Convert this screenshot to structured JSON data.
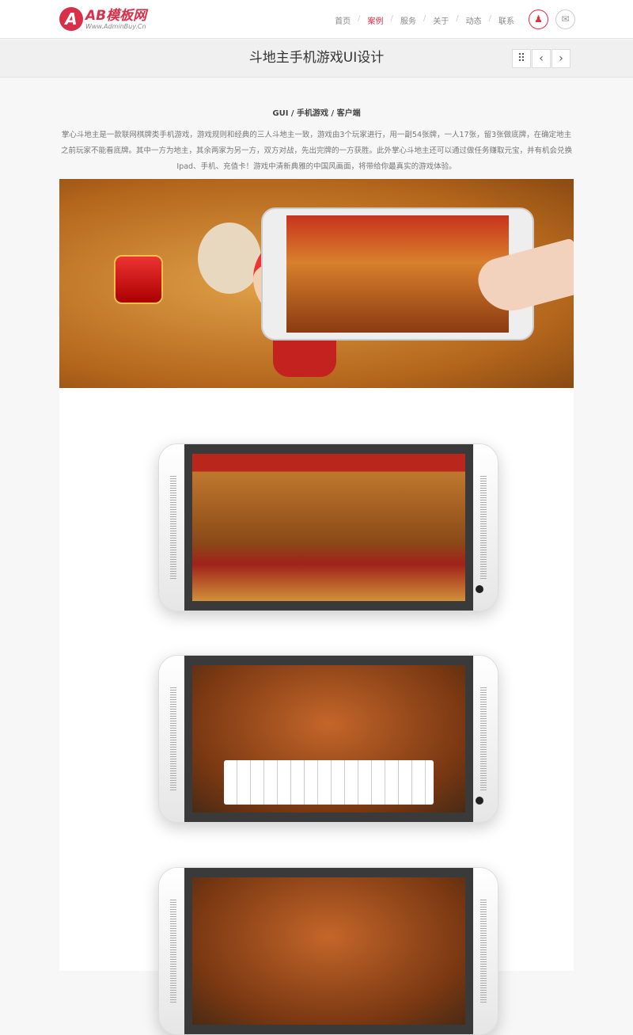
{
  "logo": {
    "name": "AB模板网",
    "url": "Www.AdminBuy.Cn",
    "mark": "A"
  },
  "nav": {
    "items": [
      "首页",
      "案例",
      "服务",
      "关于",
      "动态",
      "联系"
    ],
    "active": "案例"
  },
  "header_icons": [
    "qq-icon",
    "mail-icon"
  ],
  "page": {
    "title": "斗地主手机游戏UI设计"
  },
  "pager": {
    "grid": "grid-icon",
    "prev": "‹",
    "next": "›"
  },
  "meta": "GUI / 手机游戏 / 客户端",
  "description": "掌心斗地主是一款联网棋牌类手机游戏，游戏规则和经典的三人斗地主一致，游戏由3个玩家进行，用一副54张牌，一人17张，留3张做底牌，在确定地主之前玩家不能看底牌。其中一方为地主，其余两家为另一方，双方对战，先出完牌的一方获胜。此外掌心斗地主还可以通过做任务赚取元宝，并有机会兑换Ipad、手机、充值卡！游戏中清新典雅的中国风画面，将带给你最真实的游戏体验。",
  "colors": {
    "accent": "#d9304a"
  }
}
